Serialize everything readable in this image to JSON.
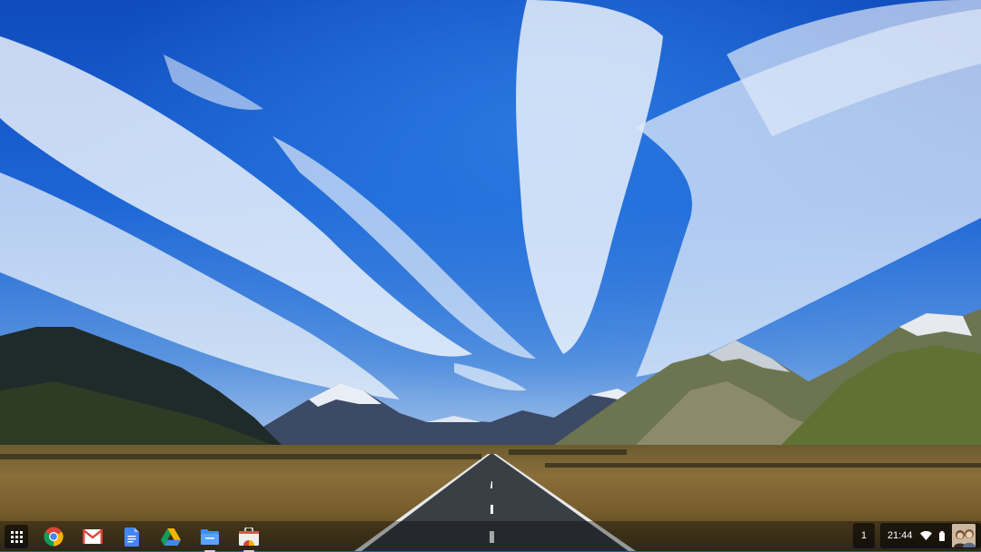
{
  "desktop": {
    "wallpaper": "mountain-road-landscape"
  },
  "shelf": {
    "launcher_icon": "app-launcher-icon",
    "apps": [
      {
        "icon": "chrome-icon",
        "running": false
      },
      {
        "icon": "gmail-icon",
        "running": false
      },
      {
        "icon": "docs-icon",
        "running": false
      },
      {
        "icon": "drive-icon",
        "running": false
      },
      {
        "icon": "files-icon",
        "running": true
      },
      {
        "icon": "web-store-icon",
        "running": true
      }
    ]
  },
  "tray": {
    "ime_indicator": "1",
    "clock": "21:44",
    "wifi_icon": "wifi-icon",
    "battery_icon": "battery-icon",
    "avatar_icon": "user-avatar-icon"
  },
  "colors": {
    "shelf_background": "#000000",
    "chrome_red": "#DB4437",
    "chrome_yellow": "#F4B400",
    "chrome_green": "#0F9D58",
    "chrome_blue": "#4285F4"
  }
}
